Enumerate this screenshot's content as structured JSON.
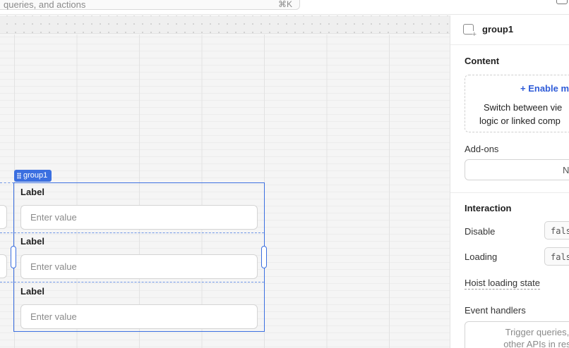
{
  "topbar": {
    "search_placeholder": "queries, and actions",
    "search_shortcut": "⌘K",
    "top_right_icon": "panel-icon"
  },
  "canvas": {
    "group_tag": "group1",
    "fields": [
      {
        "label": "Label",
        "placeholder": "Enter value"
      },
      {
        "label": "Label",
        "placeholder": "Enter value"
      },
      {
        "label": "Label",
        "placeholder": "Enter value"
      }
    ]
  },
  "inspector": {
    "title": "group1",
    "title_icon": "component-add-icon",
    "content": {
      "heading": "Content",
      "enable_link": "+ Enable m",
      "description_line1": "Switch between vie",
      "description_line2": "logic or linked comp"
    },
    "addons": {
      "label": "Add-ons",
      "value": "N"
    },
    "interaction": {
      "heading": "Interaction",
      "disable_label": "Disable",
      "disable_value": "fals",
      "loading_label": "Loading",
      "loading_value": "fals",
      "hoist_label": "Hoist loading state",
      "events_label": "Event handlers",
      "events_placeholder_line1": "Trigger queries, cont",
      "events_placeholder_line2": "other APIs in respons"
    }
  },
  "colors": {
    "selection": "#3b6fe0",
    "link": "#2e5bd8"
  }
}
